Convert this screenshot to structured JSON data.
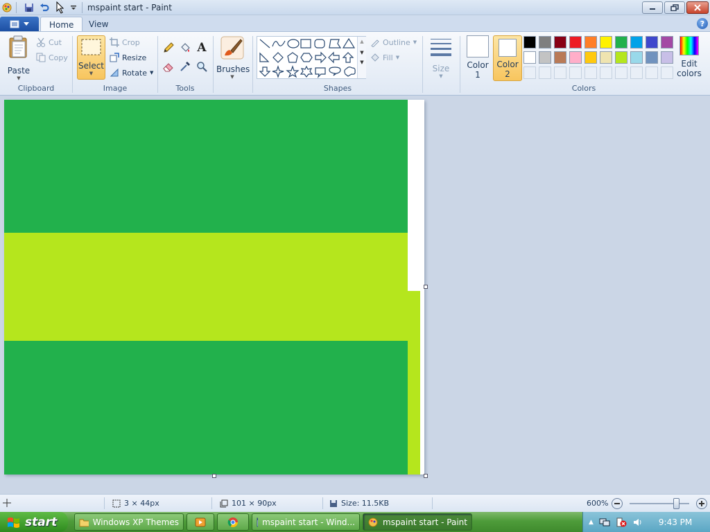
{
  "window": {
    "title": "mspaint start - Paint"
  },
  "tabs": [
    {
      "label": "Home",
      "active": true
    },
    {
      "label": "View",
      "active": false
    }
  ],
  "ribbon": {
    "clipboard": {
      "paste": "Paste",
      "cut": "Cut",
      "copy": "Copy",
      "group": "Clipboard"
    },
    "image": {
      "select": "Select",
      "crop": "Crop",
      "resize": "Resize",
      "rotate": "Rotate",
      "group": "Image"
    },
    "tools": {
      "group": "Tools"
    },
    "brushes": {
      "label": "Brushes"
    },
    "shapes": {
      "outline": "Outline",
      "fill": "Fill",
      "group": "Shapes"
    },
    "size": {
      "label": "Size"
    },
    "colors": {
      "color1_label": "Color",
      "color1_num": "1",
      "color2_label": "Color",
      "color2_num": "2",
      "edit_label": "Edit",
      "edit_label2": "colors",
      "group": "Colors",
      "color1_value": "#ffffff",
      "color2_value": "#ffffff",
      "palette_row1": [
        "#000000",
        "#7f7f7f",
        "#880015",
        "#ed1c24",
        "#ff7f27",
        "#fff200",
        "#22b14c",
        "#00a2e8",
        "#3f48cc",
        "#a349a4"
      ],
      "palette_row2": [
        "#ffffff",
        "#c3c3c3",
        "#b97a57",
        "#ffaec9",
        "#ffc90e",
        "#efe4b0",
        "#b5e61d",
        "#99d9ea",
        "#7092be",
        "#c8bfe7"
      ]
    }
  },
  "canvas": {
    "stripe_colors": {
      "green": "#22b14c",
      "lime": "#b5e61d",
      "white": "#ffffff"
    }
  },
  "status": {
    "selection_size": "3 × 44px",
    "image_size": "101 × 90px",
    "file_size": "Size: 11.5KB",
    "zoom": "600%"
  },
  "taskbar": {
    "start": "start",
    "tasks": [
      {
        "label": "Windows XP Themes",
        "active": false
      },
      {
        "label": "",
        "active": false
      },
      {
        "label": "",
        "active": false
      },
      {
        "label": "mspaint start - Wind...",
        "active": false
      },
      {
        "label": "mspaint start - Paint",
        "active": true
      }
    ],
    "clock": "9:43 PM"
  }
}
